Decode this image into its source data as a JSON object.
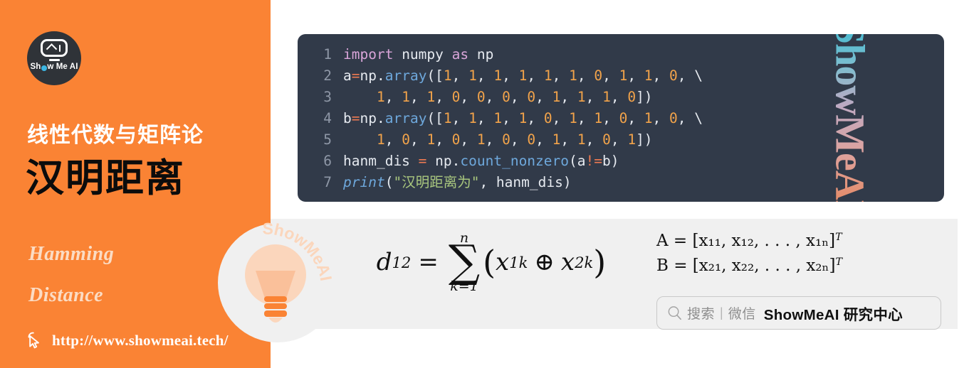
{
  "brand": {
    "logo_alt": "Show Me AI",
    "logo_text_pre": "Sh",
    "logo_text_post": "w Me AI",
    "code_watermark": "ShowMeAI",
    "bulb_watermark": "ShowMeAI",
    "orange": "#FA8334",
    "code_bg": "#313A49",
    "panel_bg": "#F0F0F0"
  },
  "left": {
    "course_title": "线性代数与矩阵论",
    "main_title": "汉明距离",
    "subtitle_en_line1": "Hamming",
    "subtitle_en_line2": "Distance",
    "url": "http://www.showmeai.tech/"
  },
  "code": {
    "language": "python",
    "lines": [
      {
        "no": "1",
        "tokens": [
          {
            "t": "import ",
            "c": "kw"
          },
          {
            "t": "numpy ",
            "c": "plain"
          },
          {
            "t": "as ",
            "c": "kw"
          },
          {
            "t": "np",
            "c": "plain"
          }
        ]
      },
      {
        "no": "2",
        "tokens": [
          {
            "t": "a",
            "c": "plain"
          },
          {
            "t": "=",
            "c": "op"
          },
          {
            "t": "np.",
            "c": "plain"
          },
          {
            "t": "array",
            "c": "fn"
          },
          {
            "t": "([",
            "c": "plain"
          },
          {
            "t": "1",
            "c": "num"
          },
          {
            "t": ", ",
            "c": "plain"
          },
          {
            "t": "1",
            "c": "num"
          },
          {
            "t": ", ",
            "c": "plain"
          },
          {
            "t": "1",
            "c": "num"
          },
          {
            "t": ", ",
            "c": "plain"
          },
          {
            "t": "1",
            "c": "num"
          },
          {
            "t": ", ",
            "c": "plain"
          },
          {
            "t": "1",
            "c": "num"
          },
          {
            "t": ", ",
            "c": "plain"
          },
          {
            "t": "1",
            "c": "num"
          },
          {
            "t": ", ",
            "c": "plain"
          },
          {
            "t": "0",
            "c": "num"
          },
          {
            "t": ", ",
            "c": "plain"
          },
          {
            "t": "1",
            "c": "num"
          },
          {
            "t": ", ",
            "c": "plain"
          },
          {
            "t": "1",
            "c": "num"
          },
          {
            "t": ", ",
            "c": "plain"
          },
          {
            "t": "0",
            "c": "num"
          },
          {
            "t": ", ",
            "c": "plain"
          },
          {
            "t": "\\",
            "c": "plain"
          }
        ]
      },
      {
        "no": "3",
        "tokens": [
          {
            "t": "    ",
            "c": "plain"
          },
          {
            "t": "1",
            "c": "num"
          },
          {
            "t": ", ",
            "c": "plain"
          },
          {
            "t": "1",
            "c": "num"
          },
          {
            "t": ", ",
            "c": "plain"
          },
          {
            "t": "1",
            "c": "num"
          },
          {
            "t": ", ",
            "c": "plain"
          },
          {
            "t": "0",
            "c": "num"
          },
          {
            "t": ", ",
            "c": "plain"
          },
          {
            "t": "0",
            "c": "num"
          },
          {
            "t": ", ",
            "c": "plain"
          },
          {
            "t": "0",
            "c": "num"
          },
          {
            "t": ", ",
            "c": "plain"
          },
          {
            "t": "0",
            "c": "num"
          },
          {
            "t": ", ",
            "c": "plain"
          },
          {
            "t": "1",
            "c": "num"
          },
          {
            "t": ", ",
            "c": "plain"
          },
          {
            "t": "1",
            "c": "num"
          },
          {
            "t": ", ",
            "c": "plain"
          },
          {
            "t": "1",
            "c": "num"
          },
          {
            "t": ", ",
            "c": "plain"
          },
          {
            "t": "0",
            "c": "num"
          },
          {
            "t": "])",
            "c": "plain"
          }
        ]
      },
      {
        "no": "4",
        "tokens": [
          {
            "t": "b",
            "c": "plain"
          },
          {
            "t": "=",
            "c": "op"
          },
          {
            "t": "np.",
            "c": "plain"
          },
          {
            "t": "array",
            "c": "fn"
          },
          {
            "t": "([",
            "c": "plain"
          },
          {
            "t": "1",
            "c": "num"
          },
          {
            "t": ", ",
            "c": "plain"
          },
          {
            "t": "1",
            "c": "num"
          },
          {
            "t": ", ",
            "c": "plain"
          },
          {
            "t": "1",
            "c": "num"
          },
          {
            "t": ", ",
            "c": "plain"
          },
          {
            "t": "1",
            "c": "num"
          },
          {
            "t": ", ",
            "c": "plain"
          },
          {
            "t": "0",
            "c": "num"
          },
          {
            "t": ", ",
            "c": "plain"
          },
          {
            "t": "1",
            "c": "num"
          },
          {
            "t": ", ",
            "c": "plain"
          },
          {
            "t": "1",
            "c": "num"
          },
          {
            "t": ", ",
            "c": "plain"
          },
          {
            "t": "0",
            "c": "num"
          },
          {
            "t": ", ",
            "c": "plain"
          },
          {
            "t": "1",
            "c": "num"
          },
          {
            "t": ", ",
            "c": "plain"
          },
          {
            "t": "0",
            "c": "num"
          },
          {
            "t": ", ",
            "c": "plain"
          },
          {
            "t": "\\",
            "c": "plain"
          }
        ]
      },
      {
        "no": "5",
        "tokens": [
          {
            "t": "    ",
            "c": "plain"
          },
          {
            "t": "1",
            "c": "num"
          },
          {
            "t": ", ",
            "c": "plain"
          },
          {
            "t": "0",
            "c": "num"
          },
          {
            "t": ", ",
            "c": "plain"
          },
          {
            "t": "1",
            "c": "num"
          },
          {
            "t": ", ",
            "c": "plain"
          },
          {
            "t": "0",
            "c": "num"
          },
          {
            "t": ", ",
            "c": "plain"
          },
          {
            "t": "1",
            "c": "num"
          },
          {
            "t": ", ",
            "c": "plain"
          },
          {
            "t": "0",
            "c": "num"
          },
          {
            "t": ", ",
            "c": "plain"
          },
          {
            "t": "0",
            "c": "num"
          },
          {
            "t": ", ",
            "c": "plain"
          },
          {
            "t": "1",
            "c": "num"
          },
          {
            "t": ", ",
            "c": "plain"
          },
          {
            "t": "1",
            "c": "num"
          },
          {
            "t": ", ",
            "c": "plain"
          },
          {
            "t": "0",
            "c": "num"
          },
          {
            "t": ", ",
            "c": "plain"
          },
          {
            "t": "1",
            "c": "num"
          },
          {
            "t": "])",
            "c": "plain"
          }
        ]
      },
      {
        "no": "6",
        "tokens": [
          {
            "t": "hanm_dis ",
            "c": "plain"
          },
          {
            "t": "=",
            "c": "op"
          },
          {
            "t": " np.",
            "c": "plain"
          },
          {
            "t": "count_nonzero",
            "c": "fn"
          },
          {
            "t": "(a",
            "c": "plain"
          },
          {
            "t": "!=",
            "c": "op"
          },
          {
            "t": "b)",
            "c": "plain"
          }
        ]
      },
      {
        "no": "7",
        "tokens": [
          {
            "t": "print",
            "c": "bi"
          },
          {
            "t": "(",
            "c": "plain"
          },
          {
            "t": "\"汉明距离为\"",
            "c": "str"
          },
          {
            "t": ", hanm_dis)",
            "c": "plain"
          }
        ]
      }
    ],
    "plain_text": "import numpy as np\na=np.array([1, 1, 1, 1, 1, 1, 0, 1, 1, 0, \\\n    1, 1, 1, 0, 0, 0, 0, 1, 1, 1, 0])\nb=np.array([1, 1, 1, 1, 0, 1, 1, 0, 1, 0, \\\n    1, 0, 1, 0, 1, 0, 0, 1, 1, 0, 1])\nhanm_dis = np.count_nonzero(a!=b)\nprint(\"汉明距离为\", hanm_dis)"
  },
  "formula": {
    "main_lhs": "d",
    "main_lhs_sub": "12",
    "equals": "=",
    "sum_upper": "n",
    "sum_lower": "k=1",
    "sum_glyph": "∑",
    "term_open": "(",
    "term_x1": "x",
    "term_x1_sub": "1k",
    "xor": "⊕",
    "term_x2": "x",
    "term_x2_sub": "2k",
    "term_close": ")",
    "vector_a": "A = [x₁₁, x₁₂, . . . , x₁ₙ]",
    "vector_a_sup": "T",
    "vector_b": "B = [x₂₁, x₂₂, . . . , x₂ₙ]",
    "vector_b_sup": "T",
    "plain": "d_12 = sum_{k=1}^{n} ( x_{1k} XOR x_{2k} )"
  },
  "wechat_badge": {
    "search_icon": "search-icon",
    "label_search": "搜索",
    "separator": "|",
    "label_platform": "微信",
    "account": "ShowMeAI 研究中心"
  }
}
